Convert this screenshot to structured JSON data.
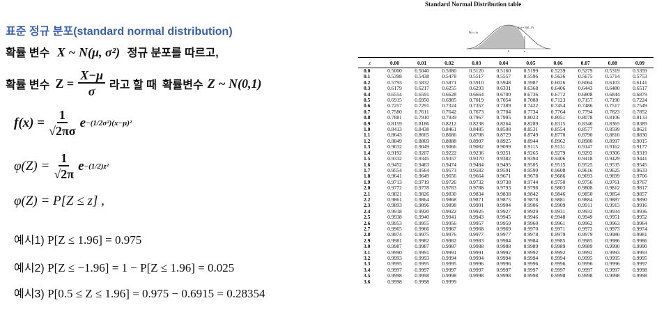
{
  "left": {
    "title": "표준 정규 분포(standard normal distribution)",
    "line2_prefix": "확률 변수",
    "line2_formula": "X ~ N(μ, σ²)",
    "line2_suffix": "정규 분포를 따르고,",
    "line3_prefix": "확률 변수",
    "line3_z": "Z =",
    "line3_num": "X−μ",
    "line3_den": "σ",
    "line3_mid": "라고 할 때",
    "line3_suffix": "확률변수",
    "line3_dist": "Z ~ N(0,1)",
    "f_lhs": "f(x) =",
    "f_num": "1",
    "f_den": "√2πσ",
    "f_exp_base": "e",
    "f_exp": "−(1/2σ²)(x−μ)²",
    "phi_lhs": "φ(Z) =",
    "phi_num": "1",
    "phi_den": "√2π",
    "phi_exp_base": "e",
    "phi_exp": "−(1/2)z²",
    "phi_cdf": "φ(Z) = P[Z ≤ z] ,",
    "ex1_label": "예시1)",
    "ex1": "P[Z ≤ 1.96] = 0.975",
    "ex2_label": "예시2)",
    "ex2": "P[Z ≤ −1.96] = 1 − P[Z ≤ 1.96] = 0.025",
    "ex3_label": "예시3)",
    "ex3": "P[0.5 ≤ Z ≤ 1.96] = 0.975  − 0.6915 = 0.28354"
  },
  "table": {
    "title": "Standard Normal Distribution table",
    "curve_left_label": "P(z ≤ z)",
    "curve_right_label": "f(z) = N(0, 1²)",
    "curve_axis_0": "0",
    "curve_axis_z": "z",
    "corner": "z",
    "columns": [
      "0.00",
      "0.01",
      "0.02",
      "0.03",
      "0.04",
      "0.05",
      "0.06",
      "0.07",
      "0.08",
      "0.09"
    ],
    "rows": [
      [
        "0.0",
        "0.5000",
        "0.5040",
        "0.5080",
        "0.5120",
        "0.5160",
        "0.5199",
        "0.5239",
        "0.5279",
        "0.5319",
        "0.5359"
      ],
      [
        "0.1",
        "0.5398",
        "0.5438",
        "0.5478",
        "0.5517",
        "0.5557",
        "0.5596",
        "0.5636",
        "0.5675",
        "0.5714",
        "0.5753"
      ],
      [
        "0.2",
        "0.5793",
        "0.5832",
        "0.5871",
        "0.5910",
        "0.5948",
        "0.5987",
        "0.6026",
        "0.6064",
        "0.6103",
        "0.6141"
      ],
      [
        "0.3",
        "0.6179",
        "0.6217",
        "0.6255",
        "0.6293",
        "0.6331",
        "0.6368",
        "0.6406",
        "0.6443",
        "0.6480",
        "0.6517"
      ],
      [
        "0.4",
        "0.6554",
        "0.6591",
        "0.6628",
        "0.6664",
        "0.6700",
        "0.6736",
        "0.6772",
        "0.6808",
        "0.6844",
        "0.6879"
      ],
      [
        "0.5",
        "0.6915",
        "0.6950",
        "0.6985",
        "0.7019",
        "0.7054",
        "0.7088",
        "0.7123",
        "0.7157",
        "0.7190",
        "0.7224"
      ],
      [
        "0.6",
        "0.7257",
        "0.7291",
        "0.7324",
        "0.7357",
        "0.7389",
        "0.7422",
        "0.7454",
        "0.7486",
        "0.7517",
        "0.7549"
      ],
      [
        "0.7",
        "0.7580",
        "0.7611",
        "0.7642",
        "0.7673",
        "0.7704",
        "0.7734",
        "0.7764",
        "0.7794",
        "0.7823",
        "0.7852"
      ],
      [
        "0.8",
        "0.7881",
        "0.7910",
        "0.7939",
        "0.7967",
        "0.7995",
        "0.8023",
        "0.8051",
        "0.8078",
        "0.8106",
        "0.8133"
      ],
      [
        "0.9",
        "0.8159",
        "0.8186",
        "0.8212",
        "0.8238",
        "0.8264",
        "0.8289",
        "0.8315",
        "0.8340",
        "0.8365",
        "0.8389"
      ],
      [
        "1.0",
        "0.8413",
        "0.8438",
        "0.8461",
        "0.8485",
        "0.8508",
        "0.8531",
        "0.8554",
        "0.8577",
        "0.8599",
        "0.8621"
      ],
      [
        "1.1",
        "0.8643",
        "0.8665",
        "0.8686",
        "0.8708",
        "0.8729",
        "0.8749",
        "0.8770",
        "0.8790",
        "0.8810",
        "0.8830"
      ],
      [
        "1.2",
        "0.8849",
        "0.8869",
        "0.8888",
        "0.8907",
        "0.8925",
        "0.8944",
        "0.8962",
        "0.8980",
        "0.8997",
        "0.9015"
      ],
      [
        "1.3",
        "0.9032",
        "0.9049",
        "0.9066",
        "0.9082",
        "0.9099",
        "0.9115",
        "0.9131",
        "0.9147",
        "0.9162",
        "0.9177"
      ],
      [
        "1.4",
        "0.9192",
        "0.9207",
        "0.9222",
        "0.9236",
        "0.9251",
        "0.9265",
        "0.9279",
        "0.9292",
        "0.9306",
        "0.9319"
      ],
      [
        "1.5",
        "0.9332",
        "0.9345",
        "0.9357",
        "0.9370",
        "0.9382",
        "0.9394",
        "0.9406",
        "0.9418",
        "0.9429",
        "0.9441"
      ],
      [
        "1.6",
        "0.9452",
        "0.9463",
        "0.9474",
        "0.9484",
        "0.9495",
        "0.9505",
        "0.9515",
        "0.9525",
        "0.9535",
        "0.9545"
      ],
      [
        "1.7",
        "0.9554",
        "0.9564",
        "0.9573",
        "0.9582",
        "0.9591",
        "0.9599",
        "0.9608",
        "0.9616",
        "0.9625",
        "0.9633"
      ],
      [
        "1.8",
        "0.9641",
        "0.9649",
        "0.9656",
        "0.9664",
        "0.9671",
        "0.9678",
        "0.9686",
        "0.9693",
        "0.9699",
        "0.9706"
      ],
      [
        "1.9",
        "0.9713",
        "0.9719",
        "0.9726",
        "0.9732",
        "0.9738",
        "0.9744",
        "0.9750",
        "0.9756",
        "0.9761",
        "0.9767"
      ],
      [
        "2.0",
        "0.9772",
        "0.9778",
        "0.9783",
        "0.9788",
        "0.9793",
        "0.9798",
        "0.9803",
        "0.9808",
        "0.9812",
        "0.9817"
      ],
      [
        "2.1",
        "0.9821",
        "0.9826",
        "0.9830",
        "0.9834",
        "0.9838",
        "0.9842",
        "0.9846",
        "0.9850",
        "0.9854",
        "0.9857"
      ],
      [
        "2.2",
        "0.9861",
        "0.9864",
        "0.9868",
        "0.9871",
        "0.9875",
        "0.9878",
        "0.9881",
        "0.9884",
        "0.9887",
        "0.9890"
      ],
      [
        "2.3",
        "0.9893",
        "0.9896",
        "0.9898",
        "0.9901",
        "0.9904",
        "0.9906",
        "0.9909",
        "0.9911",
        "0.9913",
        "0.9916"
      ],
      [
        "2.4",
        "0.9918",
        "0.9920",
        "0.9922",
        "0.9925",
        "0.9927",
        "0.9929",
        "0.9931",
        "0.9932",
        "0.9934",
        "0.9936"
      ],
      [
        "2.5",
        "0.9938",
        "0.9940",
        "0.9941",
        "0.9943",
        "0.9945",
        "0.9946",
        "0.9948",
        "0.9949",
        "0.9951",
        "0.9952"
      ],
      [
        "2.6",
        "0.9953",
        "0.9955",
        "0.9956",
        "0.9957",
        "0.9959",
        "0.9960",
        "0.9961",
        "0.9962",
        "0.9963",
        "0.9964"
      ],
      [
        "2.7",
        "0.9965",
        "0.9966",
        "0.9967",
        "0.9968",
        "0.9969",
        "0.9970",
        "0.9971",
        "0.9972",
        "0.9973",
        "0.9974"
      ],
      [
        "2.8",
        "0.9974",
        "0.9975",
        "0.9976",
        "0.9977",
        "0.9977",
        "0.9978",
        "0.9979",
        "0.9979",
        "0.9980",
        "0.9981"
      ],
      [
        "2.9",
        "0.9981",
        "0.9982",
        "0.9982",
        "0.9983",
        "0.9984",
        "0.9984",
        "0.9985",
        "0.9985",
        "0.9986",
        "0.9986"
      ],
      [
        "3.0",
        "0.9987",
        "0.9987",
        "0.9987",
        "0.9988",
        "0.9988",
        "0.9989",
        "0.9989",
        "0.9989",
        "0.9990",
        "0.9990"
      ],
      [
        "3.1",
        "0.9990",
        "0.9991",
        "0.9991",
        "0.9991",
        "0.9992",
        "0.9992",
        "0.9992",
        "0.9992",
        "0.9993",
        "0.9993"
      ],
      [
        "3.2",
        "0.9993",
        "0.9993",
        "0.9994",
        "0.9994",
        "0.9994",
        "0.9994",
        "0.9994",
        "0.9995",
        "0.9995",
        "0.9995"
      ],
      [
        "3.3",
        "0.9995",
        "0.9995",
        "0.9995",
        "0.9996",
        "0.9996",
        "0.9996",
        "0.9996",
        "0.9996",
        "0.9996",
        "0.9997"
      ],
      [
        "3.4",
        "0.9997",
        "0.9997",
        "0.9997",
        "0.9997",
        "0.9997",
        "0.9997",
        "0.9997",
        "0.9997",
        "0.9997",
        "0.9998"
      ],
      [
        "3.5",
        "0.9998",
        "0.9998",
        "0.9998",
        "0.9998",
        "0.9998",
        "0.9998",
        "0.9998",
        "0.9998",
        "0.9998",
        "0.9998"
      ],
      [
        "3.6",
        "0.9998",
        "0.9998",
        "0.9999",
        "",
        "",
        "",
        "",
        "",
        "",
        ""
      ]
    ]
  }
}
